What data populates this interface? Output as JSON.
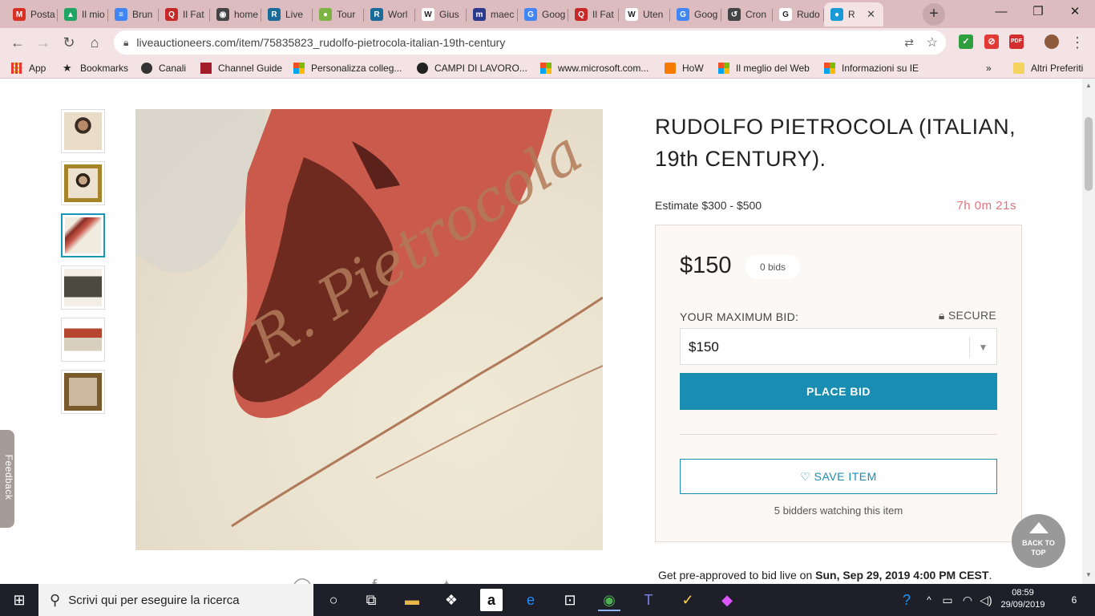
{
  "browser": {
    "tabs": [
      {
        "label": "Posta",
        "icon": "gmail-icon",
        "color": "#d93025",
        "glyph": "M"
      },
      {
        "label": "Il mio",
        "icon": "drive-icon",
        "color": "#1fa463",
        "glyph": "▲"
      },
      {
        "label": "Brun",
        "icon": "docs-icon",
        "color": "#4285f4",
        "glyph": "≡"
      },
      {
        "label": "Il Fat",
        "icon": "fatto-icon",
        "color": "#c62828",
        "glyph": "Q"
      },
      {
        "label": "home",
        "icon": "globe-icon",
        "color": "#444",
        "glyph": "◉"
      },
      {
        "label": "Live",
        "icon": "liveauctioneers-icon",
        "color": "#1a6a9a",
        "glyph": "R"
      },
      {
        "label": "Tour",
        "icon": "apple-icon",
        "color": "#7cb342",
        "glyph": "●"
      },
      {
        "label": "Worl",
        "icon": "liveauctioneers-icon",
        "color": "#1a6a9a",
        "glyph": "R"
      },
      {
        "label": "Gius",
        "icon": "wikipedia-icon",
        "color": "#fff",
        "glyph": "W"
      },
      {
        "label": "maec",
        "icon": "museum-icon",
        "color": "#2b3a8c",
        "glyph": "m"
      },
      {
        "label": "Goog",
        "icon": "translate-icon",
        "color": "#4285f4",
        "glyph": "G"
      },
      {
        "label": "Il Fat",
        "icon": "fatto-icon",
        "color": "#c62828",
        "glyph": "Q"
      },
      {
        "label": "Uten",
        "icon": "wikipedia-icon",
        "color": "#fff",
        "glyph": "W"
      },
      {
        "label": "Goog",
        "icon": "translate-icon",
        "color": "#4285f4",
        "glyph": "G"
      },
      {
        "label": "Cron",
        "icon": "history-icon",
        "color": "#444",
        "glyph": "↺"
      },
      {
        "label": "Rudo",
        "icon": "google-icon",
        "color": "#fff",
        "glyph": "G"
      },
      {
        "label": "R",
        "icon": "loading-icon",
        "color": "#1a9bd7",
        "glyph": "●"
      }
    ],
    "url": "liveauctioneers.com/item/75835823_rudolfo-pietrocola-italian-19th-century",
    "bookmarks": [
      {
        "label": "App",
        "icon": "apps-grid-icon"
      },
      {
        "label": "Bookmarks",
        "icon": "star-icon"
      },
      {
        "label": "Canali",
        "icon": "globe-icon"
      },
      {
        "label": "Channel Guide",
        "icon": "channel-guide-icon"
      },
      {
        "label": "Personalizza colleg...",
        "icon": "microsoft-icon"
      },
      {
        "label": "CAMPI DI LAVORO...",
        "icon": "campi-icon"
      },
      {
        "label": "www.microsoft.com...",
        "icon": "microsoft-icon"
      },
      {
        "label": "HoW",
        "icon": "how-icon"
      },
      {
        "label": "Il meglio del Web",
        "icon": "microsoft-icon"
      },
      {
        "label": "Informazioni su IE",
        "icon": "microsoft-icon"
      },
      {
        "label": "»",
        "icon": "chevron-right-icon"
      },
      {
        "label": "Altri Preferiti",
        "icon": "folder-icon"
      }
    ]
  },
  "item": {
    "title": "RUDOLFO PIETROCOLA (ITALIAN, 19th CENTURY).",
    "estimate": "Estimate $300 - $500",
    "countdown": "7h 0m 21s",
    "current_price": "$150",
    "bids": "0 bids",
    "max_bid_label": "YOUR MAXIMUM BID:",
    "secure_label": "SECURE",
    "selected_bid": "$150",
    "place_bid_label": "PLACE BID",
    "save_item_label": "SAVE ITEM",
    "watching": "5 bidders watching this item",
    "preapproved_prefix": "Get pre-approved to bid live on ",
    "preapproved_date": "Sun, Sep 29, 2019 4:00 PM CEST",
    "preapproved_suffix": ".",
    "signature": "R. Pietrocola"
  },
  "page": {
    "feedback_label": "Feedback",
    "back_to_top_line1": "BACK TO",
    "back_to_top_line2": "TOP"
  },
  "taskbar": {
    "search_placeholder": "Scrivi qui per eseguire la ricerca",
    "time": "08:59",
    "date": "29/09/2019",
    "notification_count": "6"
  },
  "colors": {
    "accent": "#1a8db3",
    "countdown": "#e0737a",
    "tabstrip": "#dcbcbf"
  }
}
